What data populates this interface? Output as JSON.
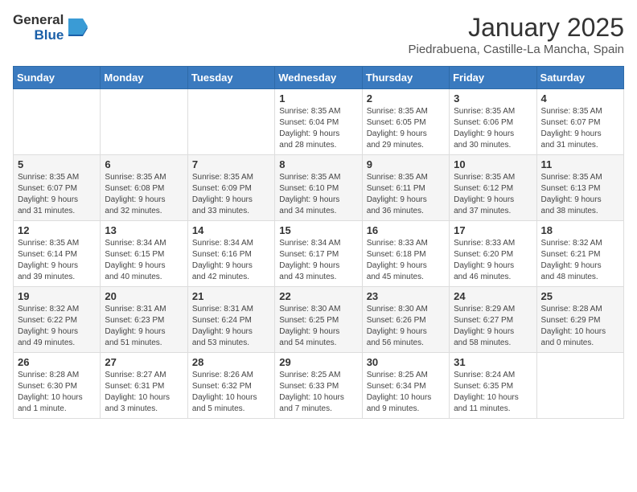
{
  "header": {
    "logo_general": "General",
    "logo_blue": "Blue",
    "title": "January 2025",
    "subtitle": "Piedrabuena, Castille-La Mancha, Spain"
  },
  "weekdays": [
    "Sunday",
    "Monday",
    "Tuesday",
    "Wednesday",
    "Thursday",
    "Friday",
    "Saturday"
  ],
  "weeks": [
    [
      {
        "day": "",
        "info": ""
      },
      {
        "day": "",
        "info": ""
      },
      {
        "day": "",
        "info": ""
      },
      {
        "day": "1",
        "info": "Sunrise: 8:35 AM\nSunset: 6:04 PM\nDaylight: 9 hours\nand 28 minutes."
      },
      {
        "day": "2",
        "info": "Sunrise: 8:35 AM\nSunset: 6:05 PM\nDaylight: 9 hours\nand 29 minutes."
      },
      {
        "day": "3",
        "info": "Sunrise: 8:35 AM\nSunset: 6:06 PM\nDaylight: 9 hours\nand 30 minutes."
      },
      {
        "day": "4",
        "info": "Sunrise: 8:35 AM\nSunset: 6:07 PM\nDaylight: 9 hours\nand 31 minutes."
      }
    ],
    [
      {
        "day": "5",
        "info": "Sunrise: 8:35 AM\nSunset: 6:07 PM\nDaylight: 9 hours\nand 31 minutes."
      },
      {
        "day": "6",
        "info": "Sunrise: 8:35 AM\nSunset: 6:08 PM\nDaylight: 9 hours\nand 32 minutes."
      },
      {
        "day": "7",
        "info": "Sunrise: 8:35 AM\nSunset: 6:09 PM\nDaylight: 9 hours\nand 33 minutes."
      },
      {
        "day": "8",
        "info": "Sunrise: 8:35 AM\nSunset: 6:10 PM\nDaylight: 9 hours\nand 34 minutes."
      },
      {
        "day": "9",
        "info": "Sunrise: 8:35 AM\nSunset: 6:11 PM\nDaylight: 9 hours\nand 36 minutes."
      },
      {
        "day": "10",
        "info": "Sunrise: 8:35 AM\nSunset: 6:12 PM\nDaylight: 9 hours\nand 37 minutes."
      },
      {
        "day": "11",
        "info": "Sunrise: 8:35 AM\nSunset: 6:13 PM\nDaylight: 9 hours\nand 38 minutes."
      }
    ],
    [
      {
        "day": "12",
        "info": "Sunrise: 8:35 AM\nSunset: 6:14 PM\nDaylight: 9 hours\nand 39 minutes."
      },
      {
        "day": "13",
        "info": "Sunrise: 8:34 AM\nSunset: 6:15 PM\nDaylight: 9 hours\nand 40 minutes."
      },
      {
        "day": "14",
        "info": "Sunrise: 8:34 AM\nSunset: 6:16 PM\nDaylight: 9 hours\nand 42 minutes."
      },
      {
        "day": "15",
        "info": "Sunrise: 8:34 AM\nSunset: 6:17 PM\nDaylight: 9 hours\nand 43 minutes."
      },
      {
        "day": "16",
        "info": "Sunrise: 8:33 AM\nSunset: 6:18 PM\nDaylight: 9 hours\nand 45 minutes."
      },
      {
        "day": "17",
        "info": "Sunrise: 8:33 AM\nSunset: 6:20 PM\nDaylight: 9 hours\nand 46 minutes."
      },
      {
        "day": "18",
        "info": "Sunrise: 8:32 AM\nSunset: 6:21 PM\nDaylight: 9 hours\nand 48 minutes."
      }
    ],
    [
      {
        "day": "19",
        "info": "Sunrise: 8:32 AM\nSunset: 6:22 PM\nDaylight: 9 hours\nand 49 minutes."
      },
      {
        "day": "20",
        "info": "Sunrise: 8:31 AM\nSunset: 6:23 PM\nDaylight: 9 hours\nand 51 minutes."
      },
      {
        "day": "21",
        "info": "Sunrise: 8:31 AM\nSunset: 6:24 PM\nDaylight: 9 hours\nand 53 minutes."
      },
      {
        "day": "22",
        "info": "Sunrise: 8:30 AM\nSunset: 6:25 PM\nDaylight: 9 hours\nand 54 minutes."
      },
      {
        "day": "23",
        "info": "Sunrise: 8:30 AM\nSunset: 6:26 PM\nDaylight: 9 hours\nand 56 minutes."
      },
      {
        "day": "24",
        "info": "Sunrise: 8:29 AM\nSunset: 6:27 PM\nDaylight: 9 hours\nand 58 minutes."
      },
      {
        "day": "25",
        "info": "Sunrise: 8:28 AM\nSunset: 6:29 PM\nDaylight: 10 hours\nand 0 minutes."
      }
    ],
    [
      {
        "day": "26",
        "info": "Sunrise: 8:28 AM\nSunset: 6:30 PM\nDaylight: 10 hours\nand 1 minute."
      },
      {
        "day": "27",
        "info": "Sunrise: 8:27 AM\nSunset: 6:31 PM\nDaylight: 10 hours\nand 3 minutes."
      },
      {
        "day": "28",
        "info": "Sunrise: 8:26 AM\nSunset: 6:32 PM\nDaylight: 10 hours\nand 5 minutes."
      },
      {
        "day": "29",
        "info": "Sunrise: 8:25 AM\nSunset: 6:33 PM\nDaylight: 10 hours\nand 7 minutes."
      },
      {
        "day": "30",
        "info": "Sunrise: 8:25 AM\nSunset: 6:34 PM\nDaylight: 10 hours\nand 9 minutes."
      },
      {
        "day": "31",
        "info": "Sunrise: 8:24 AM\nSunset: 6:35 PM\nDaylight: 10 hours\nand 11 minutes."
      },
      {
        "day": "",
        "info": ""
      }
    ]
  ]
}
